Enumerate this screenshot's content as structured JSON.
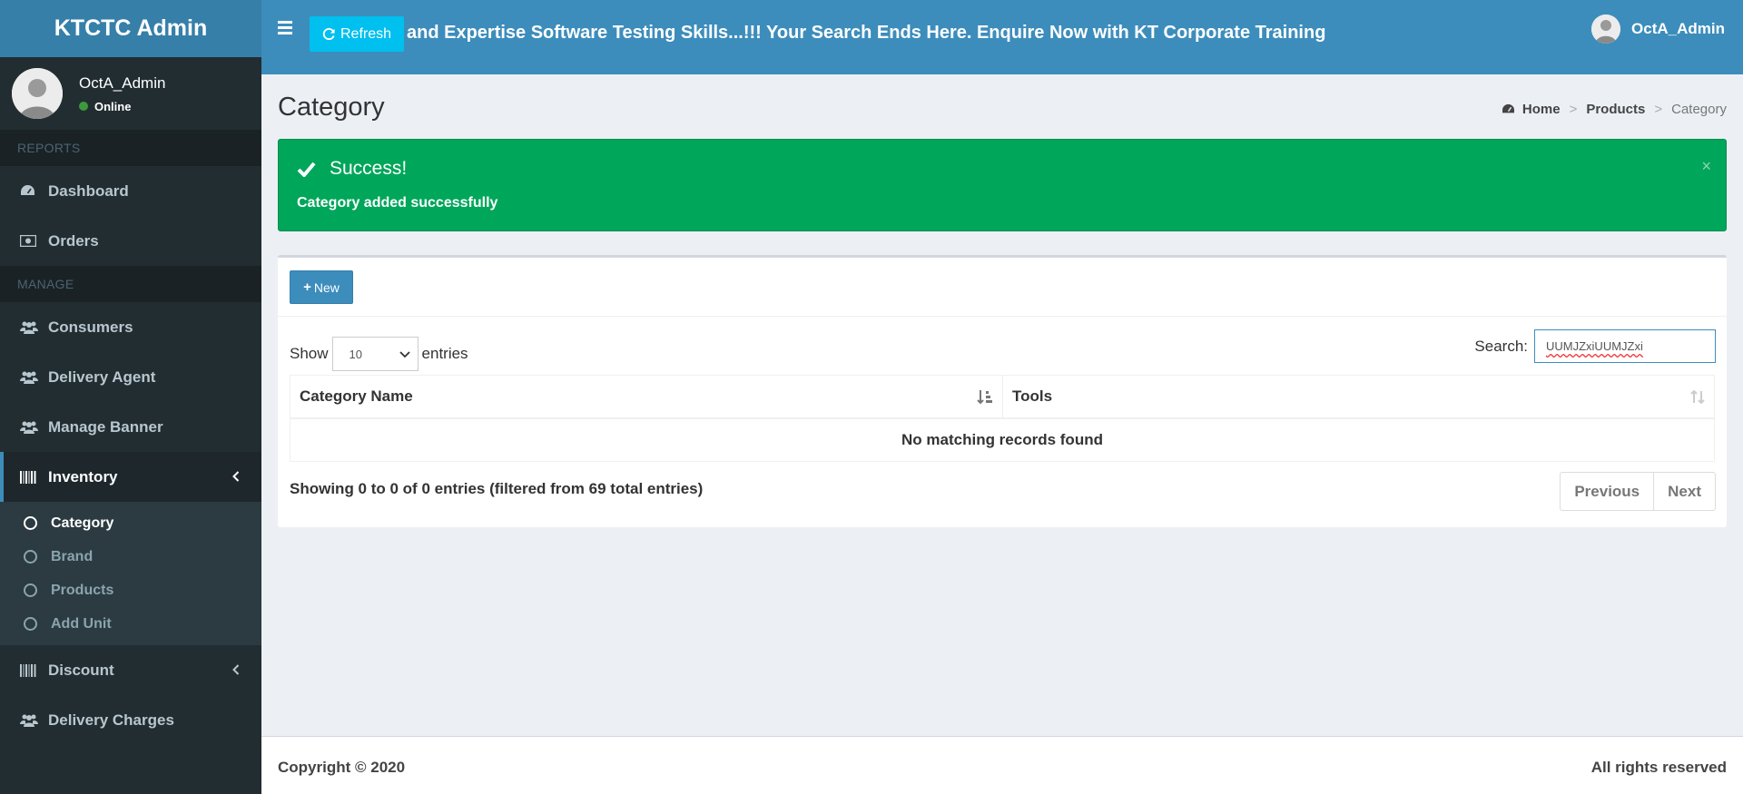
{
  "sidebar": {
    "logo": "KTCTC Admin",
    "user": {
      "name": "OctA_Admin",
      "status": "Online"
    },
    "headers": {
      "reports": "REPORTS",
      "manage": "MANAGE"
    },
    "items": {
      "dashboard": "Dashboard",
      "orders": "Orders",
      "consumers": "Consumers",
      "delivery_agent": "Delivery Agent",
      "manage_banner": "Manage Banner",
      "inventory": "Inventory",
      "discount": "Discount",
      "delivery_charges": "Delivery Charges"
    },
    "inventory_sub": {
      "category": "Category",
      "brand": "Brand",
      "products": "Products",
      "add_unit": "Add Unit"
    }
  },
  "topbar": {
    "refresh_label": "Refresh",
    "marquee": "and Expertise Software Testing Skills...!!! Your Search Ends Here. Enquire Now with KT Corporate Training",
    "user_name": "OctA_Admin"
  },
  "page": {
    "title": "Category",
    "breadcrumb": {
      "home": "Home",
      "products": "Products",
      "current": "Category"
    }
  },
  "alert": {
    "title": "Success!",
    "message": "Category added successfully",
    "close": "×"
  },
  "table_controls": {
    "new_label": "New",
    "show_label": "Show",
    "entries_value": "10",
    "entries_label": "entries",
    "search_label": "Search:",
    "search_value": "UUMJZxiUUMJZxi"
  },
  "table": {
    "columns": [
      "Category Name",
      "Tools"
    ],
    "empty_message": "No matching records found"
  },
  "pagination": {
    "info": "Showing 0 to 0 of 0 entries (filtered from 69 total entries)",
    "previous": "Previous",
    "next": "Next"
  },
  "footer": {
    "copyright": "Copyright © 2020",
    "rights": "All rights reserved"
  },
  "colors": {
    "brand": "#3c8dbc",
    "sidebar": "#222d32",
    "success": "#00a65a",
    "refresh": "#00c0ef"
  }
}
